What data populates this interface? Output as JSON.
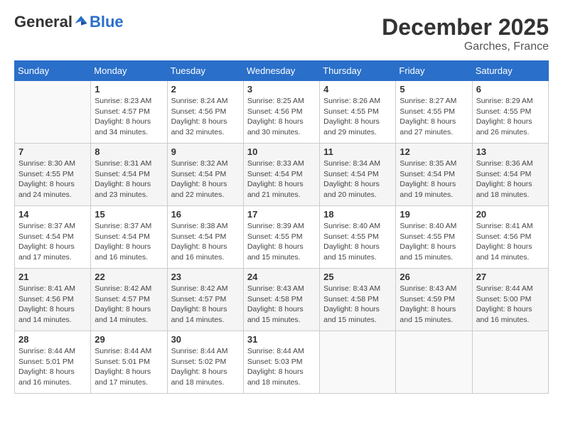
{
  "header": {
    "logo_general": "General",
    "logo_blue": "Blue",
    "month": "December 2025",
    "location": "Garches, France"
  },
  "days_of_week": [
    "Sunday",
    "Monday",
    "Tuesday",
    "Wednesday",
    "Thursday",
    "Friday",
    "Saturday"
  ],
  "weeks": [
    [
      {
        "day": "",
        "detail": ""
      },
      {
        "day": "1",
        "detail": "Sunrise: 8:23 AM\nSunset: 4:57 PM\nDaylight: 8 hours\nand 34 minutes."
      },
      {
        "day": "2",
        "detail": "Sunrise: 8:24 AM\nSunset: 4:56 PM\nDaylight: 8 hours\nand 32 minutes."
      },
      {
        "day": "3",
        "detail": "Sunrise: 8:25 AM\nSunset: 4:56 PM\nDaylight: 8 hours\nand 30 minutes."
      },
      {
        "day": "4",
        "detail": "Sunrise: 8:26 AM\nSunset: 4:55 PM\nDaylight: 8 hours\nand 29 minutes."
      },
      {
        "day": "5",
        "detail": "Sunrise: 8:27 AM\nSunset: 4:55 PM\nDaylight: 8 hours\nand 27 minutes."
      },
      {
        "day": "6",
        "detail": "Sunrise: 8:29 AM\nSunset: 4:55 PM\nDaylight: 8 hours\nand 26 minutes."
      }
    ],
    [
      {
        "day": "7",
        "detail": "Sunrise: 8:30 AM\nSunset: 4:55 PM\nDaylight: 8 hours\nand 24 minutes."
      },
      {
        "day": "8",
        "detail": "Sunrise: 8:31 AM\nSunset: 4:54 PM\nDaylight: 8 hours\nand 23 minutes."
      },
      {
        "day": "9",
        "detail": "Sunrise: 8:32 AM\nSunset: 4:54 PM\nDaylight: 8 hours\nand 22 minutes."
      },
      {
        "day": "10",
        "detail": "Sunrise: 8:33 AM\nSunset: 4:54 PM\nDaylight: 8 hours\nand 21 minutes."
      },
      {
        "day": "11",
        "detail": "Sunrise: 8:34 AM\nSunset: 4:54 PM\nDaylight: 8 hours\nand 20 minutes."
      },
      {
        "day": "12",
        "detail": "Sunrise: 8:35 AM\nSunset: 4:54 PM\nDaylight: 8 hours\nand 19 minutes."
      },
      {
        "day": "13",
        "detail": "Sunrise: 8:36 AM\nSunset: 4:54 PM\nDaylight: 8 hours\nand 18 minutes."
      }
    ],
    [
      {
        "day": "14",
        "detail": "Sunrise: 8:37 AM\nSunset: 4:54 PM\nDaylight: 8 hours\nand 17 minutes."
      },
      {
        "day": "15",
        "detail": "Sunrise: 8:37 AM\nSunset: 4:54 PM\nDaylight: 8 hours\nand 16 minutes."
      },
      {
        "day": "16",
        "detail": "Sunrise: 8:38 AM\nSunset: 4:54 PM\nDaylight: 8 hours\nand 16 minutes."
      },
      {
        "day": "17",
        "detail": "Sunrise: 8:39 AM\nSunset: 4:55 PM\nDaylight: 8 hours\nand 15 minutes."
      },
      {
        "day": "18",
        "detail": "Sunrise: 8:40 AM\nSunset: 4:55 PM\nDaylight: 8 hours\nand 15 minutes."
      },
      {
        "day": "19",
        "detail": "Sunrise: 8:40 AM\nSunset: 4:55 PM\nDaylight: 8 hours\nand 15 minutes."
      },
      {
        "day": "20",
        "detail": "Sunrise: 8:41 AM\nSunset: 4:56 PM\nDaylight: 8 hours\nand 14 minutes."
      }
    ],
    [
      {
        "day": "21",
        "detail": "Sunrise: 8:41 AM\nSunset: 4:56 PM\nDaylight: 8 hours\nand 14 minutes."
      },
      {
        "day": "22",
        "detail": "Sunrise: 8:42 AM\nSunset: 4:57 PM\nDaylight: 8 hours\nand 14 minutes."
      },
      {
        "day": "23",
        "detail": "Sunrise: 8:42 AM\nSunset: 4:57 PM\nDaylight: 8 hours\nand 14 minutes."
      },
      {
        "day": "24",
        "detail": "Sunrise: 8:43 AM\nSunset: 4:58 PM\nDaylight: 8 hours\nand 15 minutes."
      },
      {
        "day": "25",
        "detail": "Sunrise: 8:43 AM\nSunset: 4:58 PM\nDaylight: 8 hours\nand 15 minutes."
      },
      {
        "day": "26",
        "detail": "Sunrise: 8:43 AM\nSunset: 4:59 PM\nDaylight: 8 hours\nand 15 minutes."
      },
      {
        "day": "27",
        "detail": "Sunrise: 8:44 AM\nSunset: 5:00 PM\nDaylight: 8 hours\nand 16 minutes."
      }
    ],
    [
      {
        "day": "28",
        "detail": "Sunrise: 8:44 AM\nSunset: 5:01 PM\nDaylight: 8 hours\nand 16 minutes."
      },
      {
        "day": "29",
        "detail": "Sunrise: 8:44 AM\nSunset: 5:01 PM\nDaylight: 8 hours\nand 17 minutes."
      },
      {
        "day": "30",
        "detail": "Sunrise: 8:44 AM\nSunset: 5:02 PM\nDaylight: 8 hours\nand 18 minutes."
      },
      {
        "day": "31",
        "detail": "Sunrise: 8:44 AM\nSunset: 5:03 PM\nDaylight: 8 hours\nand 18 minutes."
      },
      {
        "day": "",
        "detail": ""
      },
      {
        "day": "",
        "detail": ""
      },
      {
        "day": "",
        "detail": ""
      }
    ]
  ]
}
